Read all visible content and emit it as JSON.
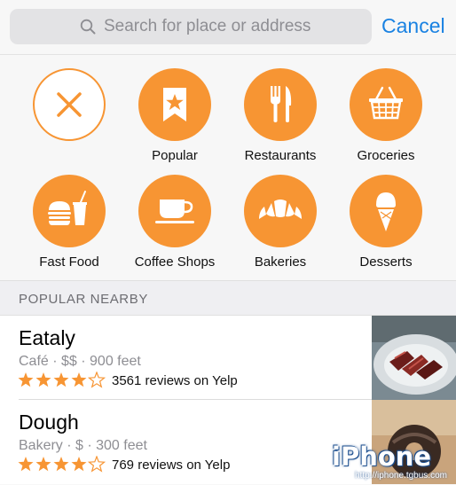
{
  "search": {
    "placeholder": "Search for place or address",
    "cancel_label": "Cancel"
  },
  "categories": [
    {
      "label": "",
      "icon": "close-icon"
    },
    {
      "label": "Popular",
      "icon": "bookmark-star-icon"
    },
    {
      "label": "Restaurants",
      "icon": "fork-knife-icon"
    },
    {
      "label": "Groceries",
      "icon": "basket-icon"
    },
    {
      "label": "Fast Food",
      "icon": "burger-drink-icon"
    },
    {
      "label": "Coffee Shops",
      "icon": "coffee-cup-icon"
    },
    {
      "label": "Bakeries",
      "icon": "croissant-icon"
    },
    {
      "label": "Desserts",
      "icon": "ice-cream-icon"
    }
  ],
  "section": {
    "title": "POPULAR NEARBY"
  },
  "results": [
    {
      "name": "Eataly",
      "meta": "Café · $$ · 900 feet",
      "rating": 4,
      "reviews": "3561 reviews on Yelp"
    },
    {
      "name": "Dough",
      "meta": "Bakery · $ · 300 feet",
      "rating": 4.5,
      "reviews": "769 reviews on Yelp"
    }
  ],
  "watermark": {
    "brand": "iPhone",
    "url": "http://iphone.tgbus.com"
  },
  "colors": {
    "accent_orange": "#f79533",
    "link_blue": "#1a82e2",
    "star_orange": "#f79533"
  }
}
